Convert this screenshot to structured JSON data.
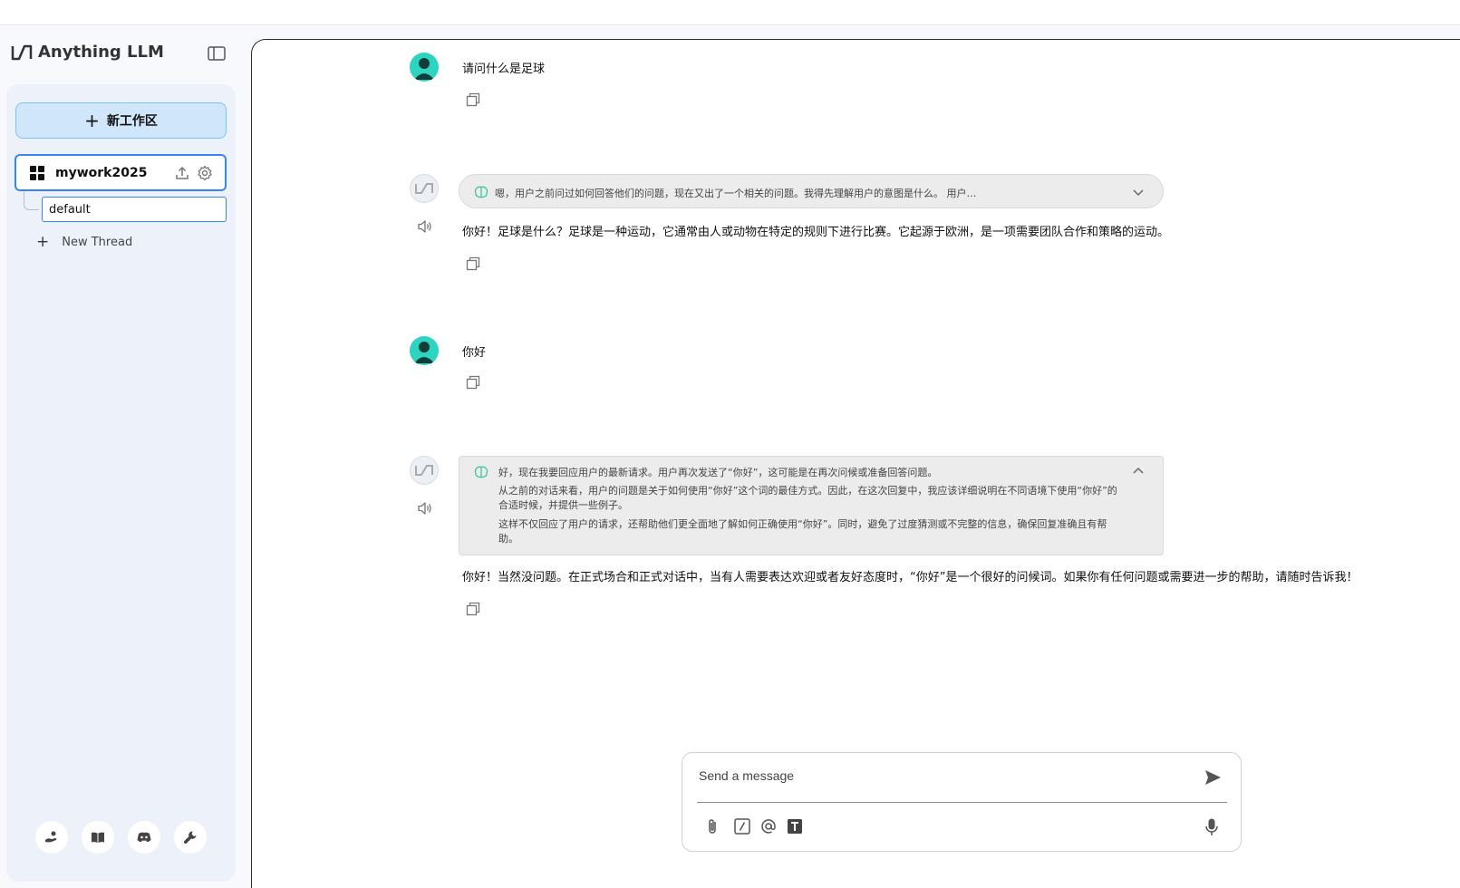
{
  "app": {
    "name": "Anything LLM"
  },
  "sidebar": {
    "new_workspace_label": "新工作区",
    "workspace": {
      "name": "mywork2025"
    },
    "threads": [
      {
        "name": "default"
      }
    ],
    "new_thread_label": "New Thread"
  },
  "chat": {
    "messages": [
      {
        "role": "user",
        "text": "请问什么是足球"
      },
      {
        "role": "assistant",
        "thought_preview": "嗯，用户之前问过如何回答他们的问题，现在又出了一个相关的问题。我得先理解用户的意图是什么。 用户…",
        "text": "你好！足球是什么？足球是一种运动，它通常由人或动物在特定的规则下进行比赛。它起源于欧洲，是一项需要团队合作和策略的运动。"
      },
      {
        "role": "user",
        "text": "你好"
      },
      {
        "role": "assistant",
        "thought_paragraphs": [
          "好，现在我要回应用户的最新请求。用户再次发送了“你好”，这可能是在再次问候或准备回答问题。",
          "从之前的对话来看，用户的问题是关于如何使用“你好”这个词的最佳方式。因此，在这次回复中，我应该详细说明在不同语境下使用“你好”的合适时候，并提供一些例子。",
          "这样不仅回应了用户的请求，还帮助他们更全面地了解如何正确使用“你好”。同时，避免了过度猜测或不完整的信息，确保回复准确且有帮助。"
        ],
        "text": "你好！当然没问题。在正式场合和正式对话中，当有人需要表达欢迎或者友好态度时，“你好”是一个很好的问候词。如果你有任何问题或需要进一步的帮助，请随时告诉我！"
      }
    ]
  },
  "composer": {
    "placeholder": "Send a message"
  },
  "colors": {
    "accent": "#3b82f6",
    "new_workspace_bg": "#cfe6fb",
    "user_avatar": "#2dd4bf"
  },
  "icons": {
    "footer": [
      "community-icon",
      "docs-book-icon",
      "discord-icon",
      "settings-wrench-icon"
    ],
    "composer_tools": [
      "attach-icon",
      "slash-command-icon",
      "mention-at-icon",
      "text-format-icon"
    ]
  }
}
